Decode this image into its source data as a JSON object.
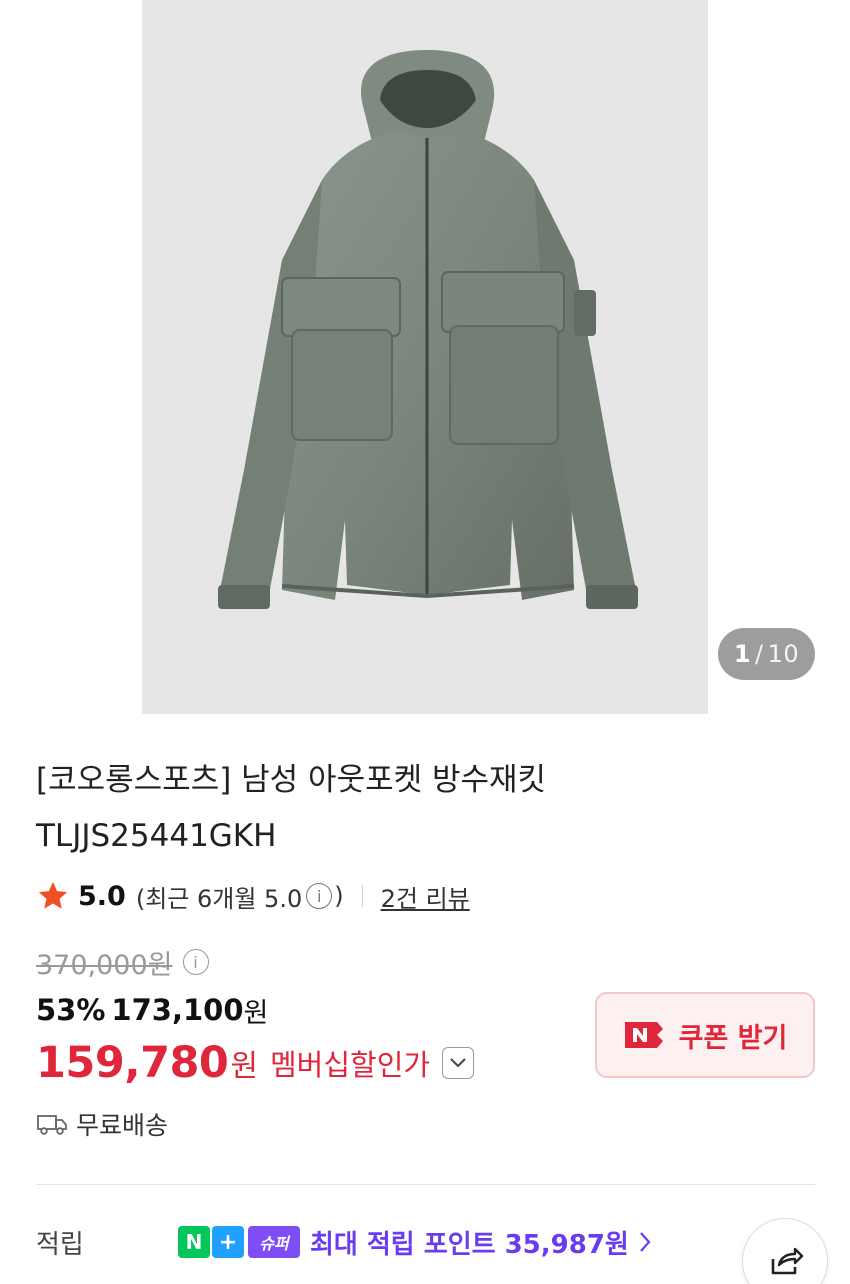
{
  "gallery": {
    "current": "1",
    "separator": "/",
    "total": "10",
    "image_alt": "gray-green hooded jacket"
  },
  "product": {
    "title_line1": "[코오롱스포츠] 남성 아웃포켓 방수재킷",
    "title_line2": "TLJJS25441GKH"
  },
  "rating": {
    "icon": "star-icon",
    "score": "5.0",
    "recent_prefix": "(최근 6개월 5.0",
    "recent_suffix": ")",
    "review_link": "2건 리뷰",
    "star_color": "#f04e23"
  },
  "price": {
    "original": "370,000원",
    "discount_pct": "53%",
    "sale_value": "173,100",
    "sale_unit": "원",
    "member_value": "159,780",
    "member_unit": "원",
    "member_label": "멤버십할인가",
    "accent_color": "#e0263b"
  },
  "coupon": {
    "label": "쿠폰 받기"
  },
  "shipping": {
    "label": "무료배송"
  },
  "points": {
    "label": "적립",
    "badge_n": "N",
    "badge_plus": "+",
    "badge_super": "슈퍼",
    "text": "최대 적립 포인트 35,987원"
  },
  "actions": {
    "share_icon": "share-icon"
  }
}
